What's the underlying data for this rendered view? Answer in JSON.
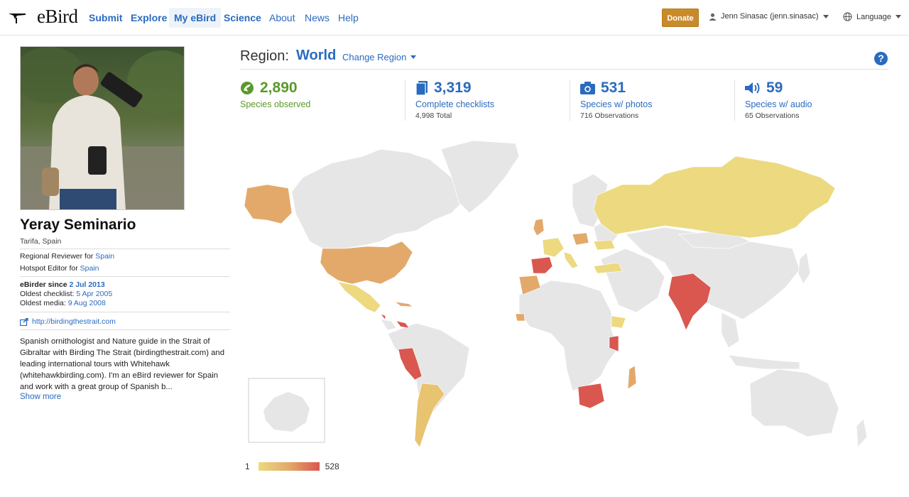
{
  "header": {
    "logo_text": "eBird",
    "nav_main": [
      "Submit",
      "Explore",
      "My eBird",
      "Science"
    ],
    "nav_secondary": [
      "About",
      "News",
      "Help"
    ],
    "active_nav": "My eBird",
    "donate_label": "Donate",
    "user_label": "Jenn Sinasac (jenn.sinasac)",
    "language_label": "Language"
  },
  "profile": {
    "name": "Yeray Seminario",
    "location": "Tarifa, Spain",
    "regional_reviewer_prefix": "Regional Reviewer for",
    "regional_reviewer_region": "Spain",
    "hotspot_editor_prefix": "Hotspot Editor for",
    "hotspot_editor_region": "Spain",
    "ebirder_since_label": "eBirder since",
    "ebirder_since_value": "2 Jul 2013",
    "oldest_checklist_label": "Oldest checklist:",
    "oldest_checklist_value": "5 Apr 2005",
    "oldest_media_label": "Oldest media:",
    "oldest_media_value": "9 Aug 2008",
    "website": "http://birdingthestrait.com",
    "bio": "Spanish ornithologist and Nature guide in the Strait of Gibraltar with Birding The Strait (birdingthestrait.com) and leading international tours with Whitehawk (whitehawkbirding.com). I'm an eBird reviewer for Spain and work with a great group of Spanish b...",
    "show_more": "Show more"
  },
  "region": {
    "label": "Region:",
    "value": "World",
    "change_label": "Change Region"
  },
  "stats": [
    {
      "icon": "species-observed-icon",
      "value": "2,890",
      "label": "Species observed",
      "sub": "",
      "color": "#5a9a2a"
    },
    {
      "icon": "checklist-icon",
      "value": "3,319",
      "label": "Complete checklists",
      "sub": "4,998 Total",
      "color": "#2a6bbf"
    },
    {
      "icon": "camera-icon",
      "value": "531",
      "label": "Species w/ photos",
      "sub": "716 Observations",
      "color": "#2a6bbf"
    },
    {
      "icon": "speaker-icon",
      "value": "59",
      "label": "Species w/ audio",
      "sub": "65 Observations",
      "color": "#2a6bbf"
    }
  ],
  "map": {
    "legend_min": "1",
    "legend_max": "528",
    "colors": {
      "low": "#ecd980",
      "mid": "#e3a96b",
      "high": "#d9574f",
      "none": "#e6e6e6"
    }
  }
}
